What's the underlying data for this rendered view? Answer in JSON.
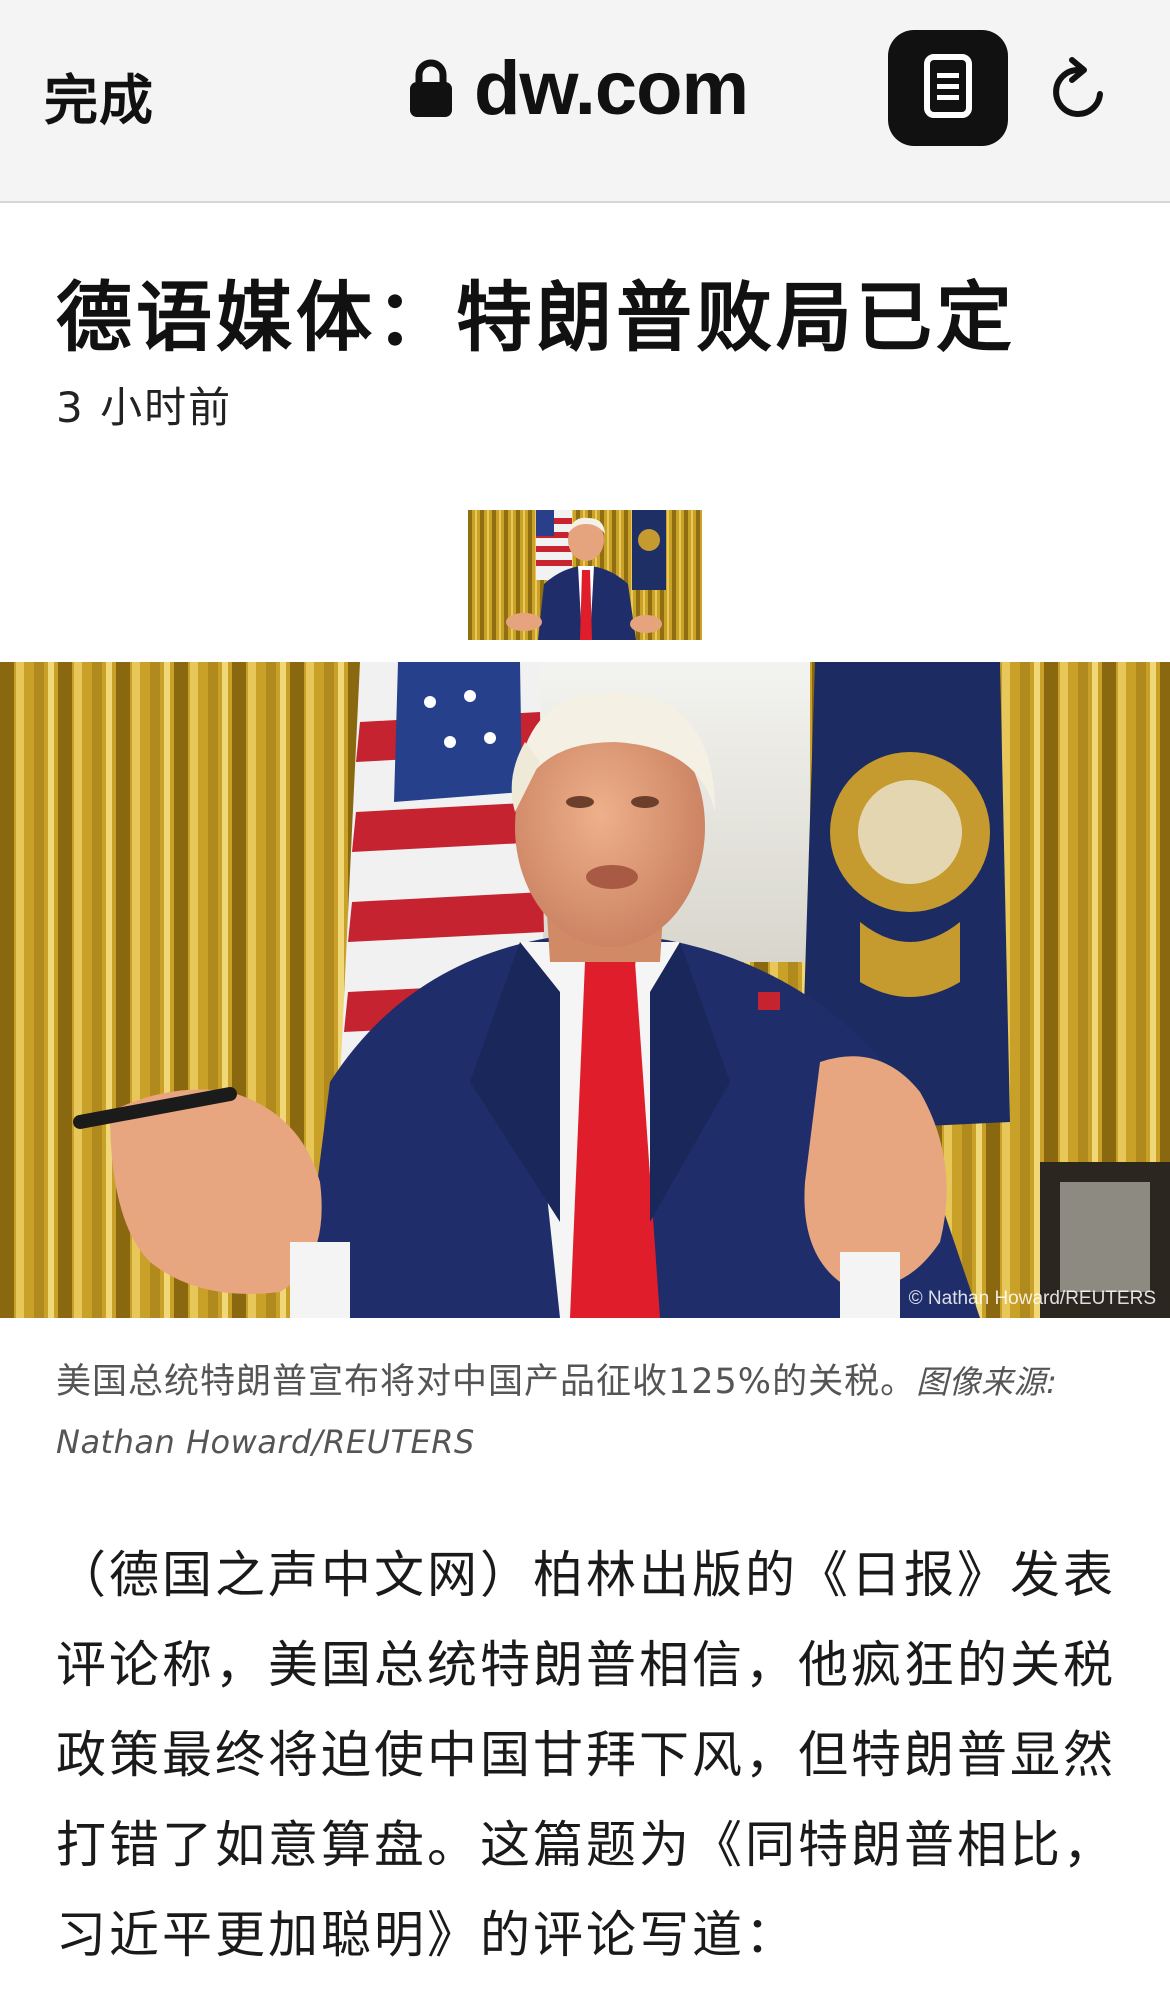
{
  "browser": {
    "done_label": "完成",
    "url": "dw.com",
    "icons": {
      "lock": "lock-icon",
      "reader": "reader-mode-icon",
      "reload": "reload-icon"
    }
  },
  "article": {
    "title": "德语媒体：特朗普败局已定",
    "timestamp": "3 小时前",
    "photo_overlay_credit": "© Nathan Howard/REUTERS",
    "caption_text": "美国总统特朗普宣布将对中国产品征收125%的关税。",
    "caption_credit": "图像来源: Nathan Howard/REUTERS",
    "body": "（德国之声中文网）柏林出版的《日报》发表评论称，美国总统特朗普相信，他疯狂的关税政策最终将迫使中国甘拜下风，但特朗普显然打错了如意算盘。这篇题为《同特朗普相比，习近平更加聪明》的评论写道："
  },
  "colors": {
    "toolbar_bg": "#f4f4f4",
    "reader_button_bg": "#111111",
    "caption_text": "#555555",
    "curtain_gold": "#c9a227",
    "suit_navy": "#1f2e6b",
    "tie_red": "#e01e2b"
  }
}
